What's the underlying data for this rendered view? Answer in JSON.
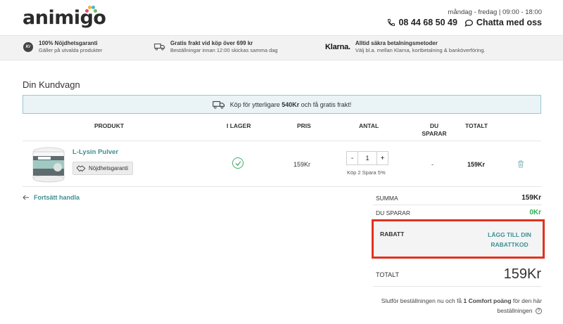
{
  "header": {
    "logo_text": "animigo",
    "hours": "måndag - fredag | 09:00 - 18:00",
    "phone": "08 44 68 50 49",
    "chat_label": "Chatta med oss"
  },
  "usp": [
    {
      "title": "100% Nöjdhetsgaranti",
      "subtitle": "Gäller på utvalda produkter",
      "icon": "kr-badge-icon"
    },
    {
      "title": "Gratis frakt vid köp över 699 kr",
      "subtitle": "Beställningar innan 12:00 skickas samma dag",
      "icon": "truck-icon"
    },
    {
      "title": "Alltid säkra betalningsmetoder",
      "subtitle": "Välj bl.a. mellan Klarna, kortbetalning & banköverföring.",
      "icon": "klarna-logo",
      "logo_text": "Klarna."
    }
  ],
  "cart": {
    "title": "Din Kundvagn",
    "shipping_notice": {
      "prefix": "Köp för ytterligare ",
      "amount": "540Kr",
      "suffix": " och få gratis frakt!"
    },
    "columns": {
      "product": "PRODUKT",
      "in_stock": "I LAGER",
      "price": "PRIS",
      "quantity": "ANTAL",
      "you_save_1": "DU",
      "you_save_2": "SPARAR",
      "total": "TOTALT"
    },
    "items": [
      {
        "name": "L-Lysin Pulver",
        "guarantee": "Nöjdhetsgaranti",
        "price": "159Kr",
        "quantity": "1",
        "qty_note": "Köp 2 Spara 5%",
        "you_save": "-",
        "total": "159Kr"
      }
    ],
    "continue_shopping": "Fortsätt handla"
  },
  "summary": {
    "sum_label": "SUMMA",
    "sum_value": "159Kr",
    "save_label": "DU SPARAR",
    "save_value": "0Kr",
    "discount_label": "RABATT",
    "discount_link": "LÄGG TILL DIN RABATTKOD",
    "total_label": "TOTALT",
    "total_value": "159Kr",
    "comfort_prefix": "Slutför beställningen nu och få ",
    "comfort_points": "1 Comfort poäng",
    "comfort_suffix": " för den här beställningen"
  },
  "colors": {
    "accent": "#3f8f93",
    "highlight_border": "#e1321e",
    "success": "#2fae56"
  }
}
